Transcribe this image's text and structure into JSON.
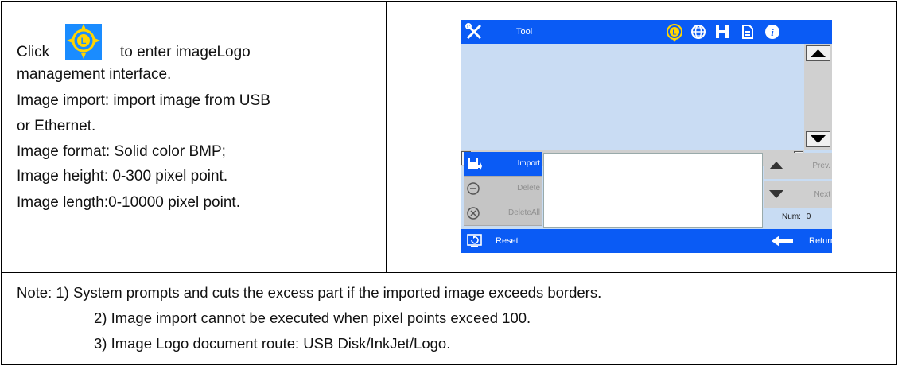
{
  "left_cell": {
    "line1_prefix": "Click",
    "line1_suffix": "to enter imageLogo",
    "line2": "management interface.",
    "line3": "Image import: import image from USB",
    "line4": "or Ethernet.",
    "line5": "Image format: Solid color BMP;",
    "line6": "Image height: 0-300 pixel point.",
    "line7": "Image length:0-10000 pixel point.",
    "logo_icon": "logo-target-icon"
  },
  "device": {
    "top_title": "Tool",
    "top_icons": [
      "tool-icon",
      "logo-target-icon",
      "globe-icon",
      "save-icon",
      "file-icon",
      "info-icon"
    ],
    "side_buttons": [
      {
        "label": "Import",
        "icon": "import-icon",
        "active": true
      },
      {
        "label": "Delete",
        "icon": "minus-circle-icon",
        "active": false
      },
      {
        "label": "DeleteAll",
        "icon": "x-circle-icon",
        "active": false
      }
    ],
    "prev_label": "Prev.",
    "next_label": "Next",
    "num_label": "Num:",
    "num_value": "0",
    "reset_label": "Reset",
    "return_label": "Return"
  },
  "notes": {
    "note1": "Note: 1) System prompts and cuts the excess part if the imported image exceeds borders.",
    "note2": "2) Image import cannot be executed when pixel points exceed 100.",
    "note3": "3) Image Logo document route: USB Disk/InkJet/Logo."
  },
  "colors": {
    "bar_blue": "#0a5bf5",
    "logo_yellow": "#ffd400",
    "canvas": "#c9dcf3"
  }
}
